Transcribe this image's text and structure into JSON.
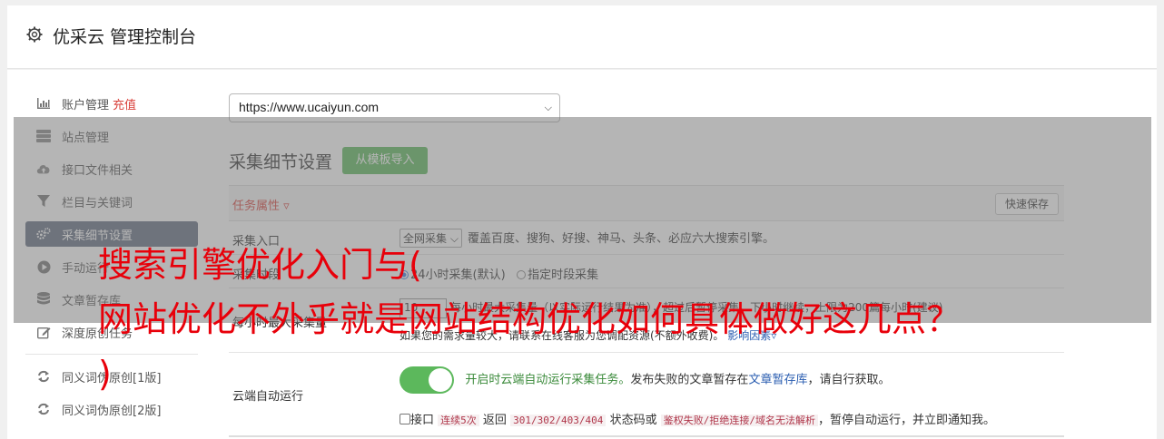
{
  "header": {
    "title": "优采云 管理控制台",
    "icon": "gear-icon"
  },
  "sidebar": {
    "items": [
      {
        "label": "账户管理",
        "badge": "充值",
        "icon": "bar-chart-icon"
      },
      {
        "label": "站点管理",
        "icon": "server-icon"
      },
      {
        "label": "接口文件相关",
        "icon": "cloud-upload-icon"
      },
      {
        "label": "栏目与关键词",
        "icon": "filter-icon"
      },
      {
        "label": "采集细节设置",
        "icon": "gears-icon",
        "active": true
      },
      {
        "label": "手动运行",
        "icon": "play-circle-icon"
      },
      {
        "label": "文章暂存库",
        "icon": "database-icon"
      },
      {
        "label": "深度原创任务",
        "icon": "edit-icon"
      }
    ],
    "items2": [
      {
        "label": "同义词伪原创[1版]",
        "icon": "refresh-icon"
      },
      {
        "label": "同义词伪原创[2版]",
        "icon": "refresh-icon"
      }
    ]
  },
  "main": {
    "site_value": "https://www.ucaiyun.com",
    "section_title": "采集细节设置",
    "import_button": "从模板导入",
    "task_attr": "任务属性 ▿",
    "quick_save": "快速保存",
    "rows": {
      "entry": {
        "label": "采集入口",
        "select": "全网采集",
        "desc": "覆盖百度、搜狗、好搜、神马、头条、必应六大搜索引擎。"
      },
      "time": {
        "label": "采集时段",
        "opt1": "24小时采集(默认)",
        "opt2": "指定时段采集"
      },
      "volume": {
        "label": "每小时最大采集量",
        "value": "10",
        "desc_line1": "每小时最大采集量（以实际运行结果为准），超过后暂停采集，下小时继续，上限为200篇每小时(建议)",
        "desc_line2": "如果您的需求量较大，请联系在线客服为您调配资源(不额外收费)。",
        "link": "影响因素"
      },
      "cloud": {
        "label": "云端自动运行",
        "on_text": "开启时云端自动运行采集任务。",
        "desc_a": "发布失败的文章暂存在",
        "link": "文章暂存库",
        "desc_b": "，请自行获取。",
        "check_label": "接口",
        "code1": "连续5次",
        "txt1": "返回",
        "code2": "301/302/403/404",
        "txt2": "状态码或",
        "code3": "鉴权失败/拒绝连接/域名无法解析",
        "txt3": "，暂停自动运行，并立即通知我。"
      }
    }
  },
  "overlay": {
    "line1": "搜索引擎优化入门与(",
    "line2": "网站优化不外乎就是网站结构优化如何具体做好这几点？",
    "line3": ")"
  }
}
